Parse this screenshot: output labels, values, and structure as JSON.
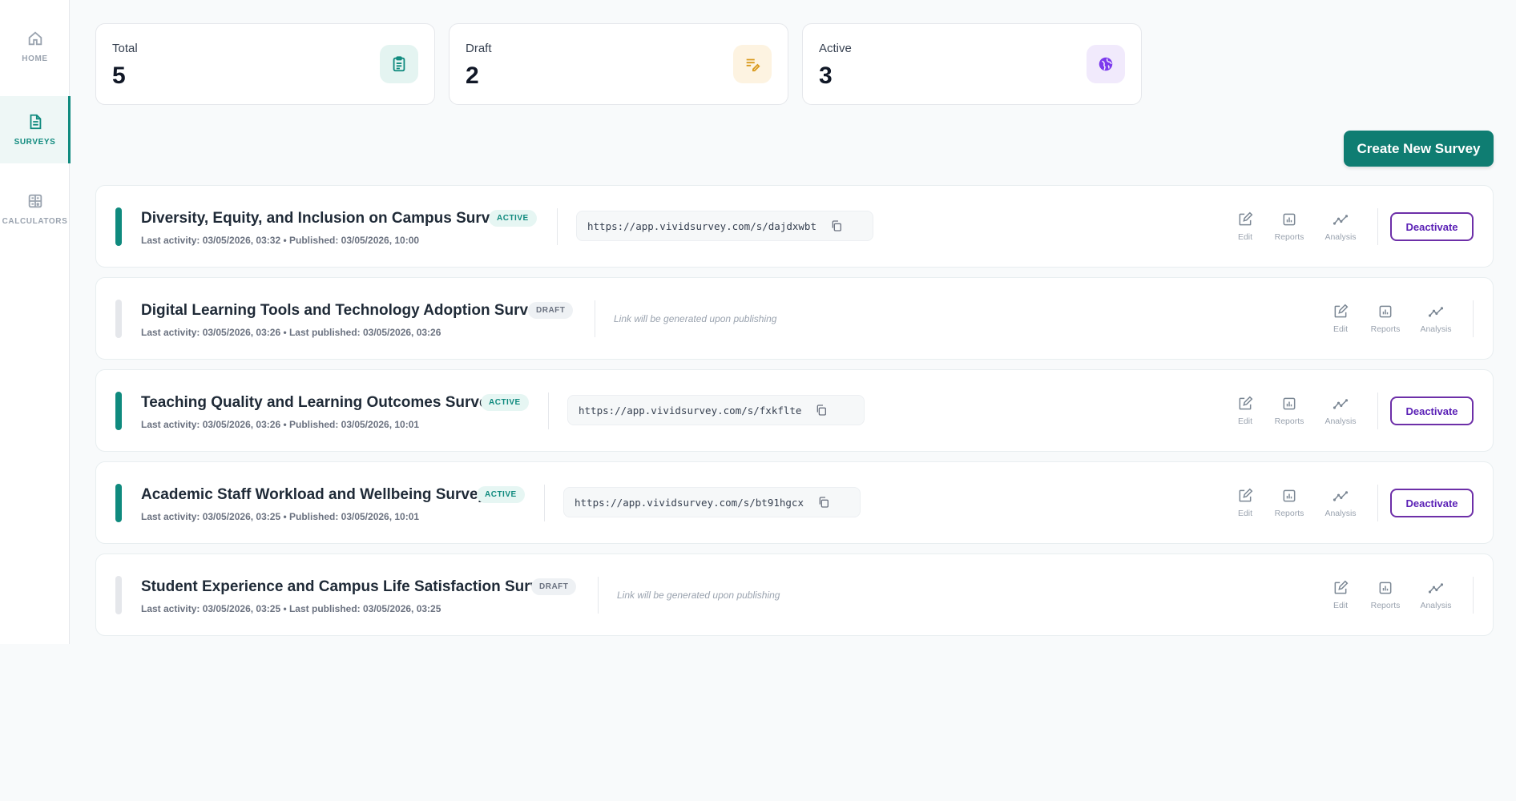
{
  "sidebar": {
    "items": [
      {
        "label": "HOME",
        "icon": "home-icon",
        "active": false
      },
      {
        "label": "SURVEYS",
        "icon": "document-icon",
        "active": true
      },
      {
        "label": "CALCULATORS",
        "icon": "calculator-icon",
        "active": false
      }
    ]
  },
  "stats": [
    {
      "label": "Total",
      "value": "5",
      "icon": "clipboard-icon",
      "color": "#0f8a7e"
    },
    {
      "label": "Draft",
      "value": "2",
      "icon": "edit-list-icon",
      "color": "#d99a1e"
    },
    {
      "label": "Active",
      "value": "3",
      "icon": "globe-icon",
      "color": "#7c3aed"
    }
  ],
  "create_button": "Create New Survey",
  "actions": {
    "edit": "Edit",
    "reports": "Reports",
    "analysis": "Analysis",
    "deactivate": "Deactivate"
  },
  "link_placeholder": "Link will be generated upon publishing",
  "colors": {
    "accent": "#0f8a7e",
    "purple": "#6d2fa8",
    "draft_bar": "#e5e7eb"
  },
  "surveys": [
    {
      "title": "Diversity, Equity, and Inclusion on Campus Survey",
      "status": "ACTIVE",
      "meta": "Last activity: 03/05/2026, 03:32 • Published: 03/05/2026, 10:00",
      "link": "https://app.vividsurvey.com/s/dajdxwbt"
    },
    {
      "title": "Digital Learning Tools and Technology Adoption Survey",
      "status": "DRAFT",
      "meta": "Last activity: 03/05/2026, 03:26 • Last published: 03/05/2026, 03:26",
      "link": ""
    },
    {
      "title": "Teaching Quality and Learning Outcomes Survey",
      "status": "ACTIVE",
      "meta": "Last activity: 03/05/2026, 03:26 • Published: 03/05/2026, 10:01",
      "link": "https://app.vividsurvey.com/s/fxkflte"
    },
    {
      "title": "Academic Staff Workload and Wellbeing Survey",
      "status": "ACTIVE",
      "meta": "Last activity: 03/05/2026, 03:25 • Published: 03/05/2026, 10:01",
      "link": "https://app.vividsurvey.com/s/bt91hgcx"
    },
    {
      "title": "Student Experience and Campus Life Satisfaction Survey",
      "status": "DRAFT",
      "meta": "Last activity: 03/05/2026, 03:25 • Last published: 03/05/2026, 03:25",
      "link": ""
    }
  ]
}
